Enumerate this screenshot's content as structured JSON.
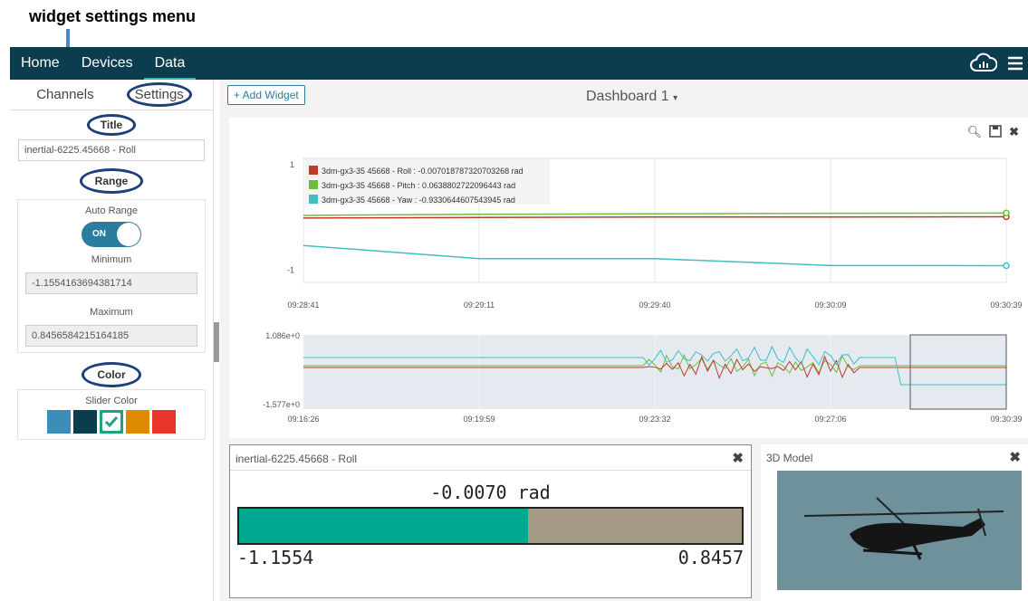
{
  "annotation": {
    "text": "widget settings menu"
  },
  "nav": {
    "items": [
      {
        "label": "Home"
      },
      {
        "label": "Devices"
      },
      {
        "label": "Data"
      }
    ],
    "cloud_icon": "cloud-chart-icon",
    "menu_icon": "hamburger-icon"
  },
  "sidebar": {
    "tabs": [
      {
        "label": "Channels"
      },
      {
        "label": "Settings"
      }
    ],
    "title_heading": "Title",
    "title_value": "inertial-6225.45668 - Roll",
    "range_heading": "Range",
    "auto_range_label": "Auto Range",
    "toggle_label": "ON",
    "minimum_label": "Minimum",
    "minimum_value": "-1.1554163694381714",
    "maximum_label": "Maximum",
    "maximum_value": "0.8456584215164185",
    "color_heading": "Color",
    "slider_color_label": "Slider Color",
    "swatches": [
      "#3a8fb7",
      "#0c3d4f",
      "#1fa37f",
      "#e08a00",
      "#e8352b"
    ]
  },
  "toolbar": {
    "add_widget": "+ Add Widget",
    "dashboard": "Dashboard 1"
  },
  "chart_data": [
    {
      "type": "line",
      "series": [
        {
          "name": "3dm-gx3-35 45668 - Roll : -0.007018787320703268 rad",
          "color": "#c0392b",
          "values": [
            -0.03,
            -0.02,
            -0.01,
            -0.01,
            -0.007
          ]
        },
        {
          "name": "3dm-gx3-35 45668 - Pitch : 0.0638802722096443 rad",
          "color": "#6dbf3a",
          "values": [
            0.02,
            0.04,
            0.05,
            0.06,
            0.064
          ]
        },
        {
          "name": "3dm-gx3-35 45668 - Yaw : -0.9330644607543945 rad",
          "color": "#3fbfc0",
          "values": [
            -0.55,
            -0.8,
            -0.8,
            -0.93,
            -0.933
          ]
        }
      ],
      "x": [
        "09:28:41",
        "09:29:11",
        "09:29:40",
        "09:30:09",
        "09:30:39"
      ],
      "ytick_labels": [
        "1",
        "-1"
      ],
      "ylim": [
        -1.25,
        1.1
      ]
    },
    {
      "type": "line",
      "x": [
        "09:16:26",
        "09:19:59",
        "09:23:32",
        "09:27:06",
        "09:30:39"
      ],
      "ytick_labels": [
        "1.086e+0",
        "-1.577e+0"
      ],
      "ylim": [
        -1.577,
        1.086
      ]
    }
  ],
  "roll_widget": {
    "title": "inertial-6225.45668 - Roll",
    "value": "-0.0070 rad",
    "min": "-1.1554",
    "max": "0.8457",
    "fill_color": "#00a88f",
    "level": 0.574
  },
  "model_widget": {
    "title": "3D Model"
  }
}
